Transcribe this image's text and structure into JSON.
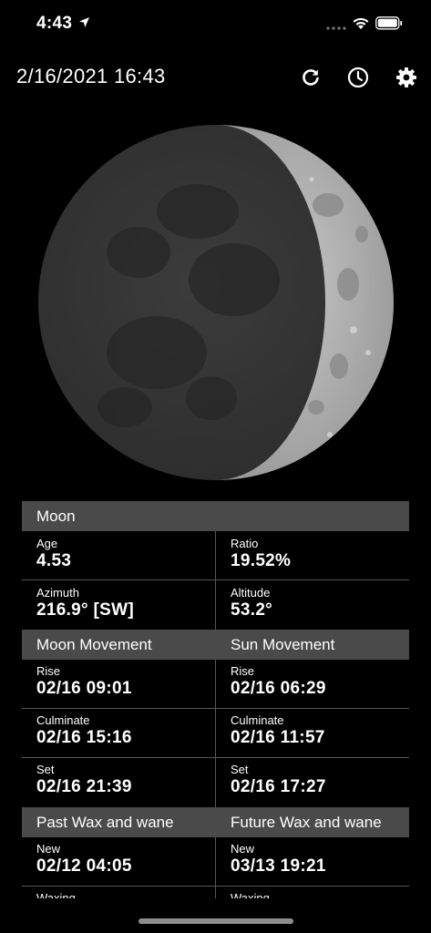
{
  "status_bar": {
    "time": "4:43"
  },
  "header": {
    "datetime": "2/16/2021 16:43",
    "icons": [
      "refresh-icon",
      "clock-icon",
      "gear-icon"
    ]
  },
  "moon_section": {
    "title": "Moon",
    "age_label": "Age",
    "age_value": "4.53",
    "ratio_label": "Ratio",
    "ratio_value": "19.52%",
    "azimuth_label": "Azimuth",
    "azimuth_value": "216.9° [SW]",
    "altitude_label": "Altitude",
    "altitude_value": "53.2°"
  },
  "movement": {
    "moon_title": "Moon Movement",
    "sun_title": "Sun Movement",
    "moon_rise_label": "Rise",
    "moon_rise_value": "02/16 09:01",
    "sun_rise_label": "Rise",
    "sun_rise_value": "02/16 06:29",
    "moon_culminate_label": "Culminate",
    "moon_culminate_value": "02/16 15:16",
    "sun_culminate_label": "Culminate",
    "sun_culminate_value": "02/16 11:57",
    "moon_set_label": "Set",
    "moon_set_value": "02/16 21:39",
    "sun_set_label": "Set",
    "sun_set_value": "02/16 17:27"
  },
  "wax_wane": {
    "past_title": "Past Wax and wane",
    "future_title": "Future Wax and wane",
    "past_new_label": "New",
    "past_new_value": "02/12 04:05",
    "future_new_label": "New",
    "future_new_value": "03/13 19:21",
    "past_waxing_label": "Waxing",
    "future_waxing_label": "Waxing"
  },
  "colors": {
    "background": "#000000",
    "section_header": "#4a4a4a",
    "divider": "#555555"
  }
}
